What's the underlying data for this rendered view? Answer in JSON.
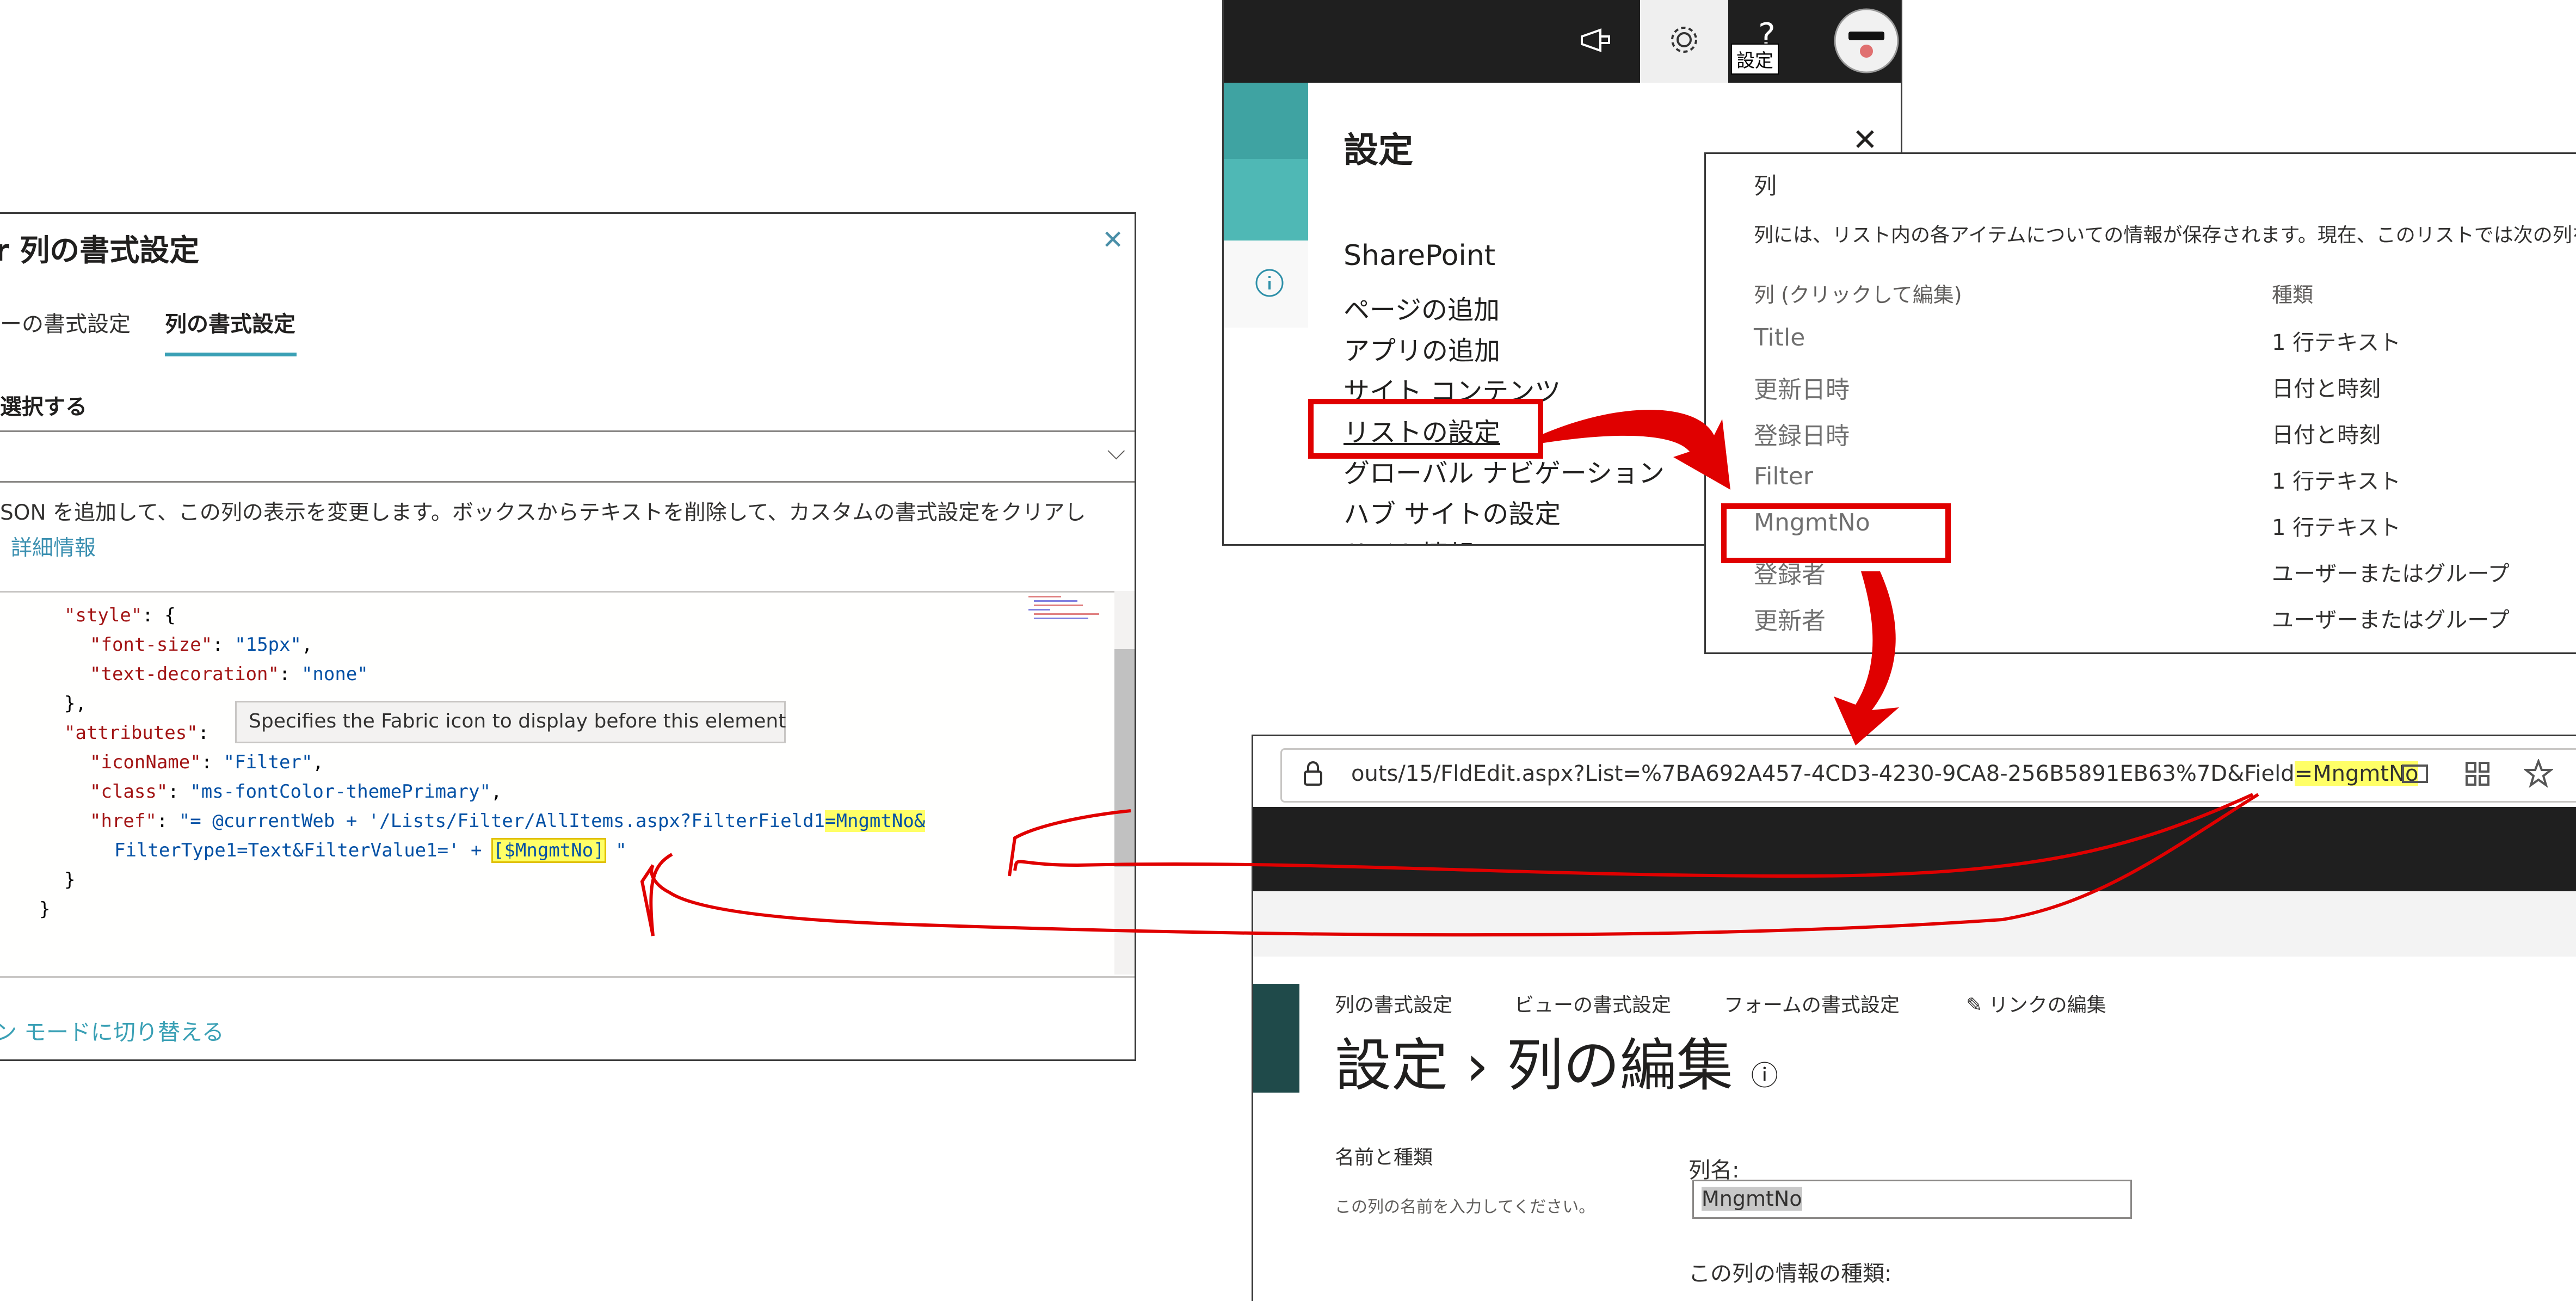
{
  "format_panel": {
    "title": "r 列の書式設定",
    "close_icon": "close-icon",
    "tab_view": "ーの書式設定",
    "tab_column": "列の書式設定",
    "select_label": "選択する",
    "description": "SON を追加して、この列の表示を変更します。ボックスからテキストを削除して、カスタムの書式設定をクリアし",
    "more_info": "詳細情報",
    "tooltip": "Specifies the Fabric icon to display before this element",
    "switch_mode": "ン モードに切り替える",
    "code": {
      "style_key": "\"style\"",
      "font_size_key": "\"font-size\"",
      "font_size_val": "\"15px\"",
      "text_decoration_key": "\"text-decoration\"",
      "text_decoration_val": "\"none\"",
      "attributes_key": "\"attributes\"",
      "icon_name_key": "\"iconName\"",
      "icon_name_val": "\"Filter\"",
      "class_key": "\"class\"",
      "class_val": "\"ms-fontColor-themePrimary\"",
      "href_key": "\"href\"",
      "href_val_1": "\"= @currentWeb + '/Lists/Filter/AllItems.aspx?FilterField1",
      "href_val_hl": "=MngmtNo&",
      "href_val_2": "FilterType1=Text&FilterValue1=' + ",
      "href_val_hl2": "[$MngmtNo]",
      "href_val_3": " \""
    }
  },
  "settings_panel": {
    "title": "設定",
    "tooltip": "設定",
    "section": "SharePoint",
    "links": [
      "ページの追加",
      "アプリの追加",
      "サイト コンテンツ",
      "リストの設定",
      "グローバル ナビゲーション",
      "ハブ サイトの設定",
      "サイト情報"
    ],
    "icons": [
      "megaphone-icon",
      "gear-icon",
      "help-icon",
      "avatar"
    ]
  },
  "columns_panel": {
    "title": "列",
    "description": "列には、リスト内の各アイテムについての情報が保存されます。現在、このリストでは次の列を使用",
    "header_name": "列 (クリックして編集)",
    "header_type": "種類",
    "rows": [
      {
        "name": "Title",
        "type": "1 行テキスト"
      },
      {
        "name": "更新日時",
        "type": "日付と時刻"
      },
      {
        "name": "登録日時",
        "type": "日付と時刻"
      },
      {
        "name": "Filter",
        "type": "1 行テキスト"
      },
      {
        "name": "MngmtNo",
        "type": "1 行テキスト"
      },
      {
        "name": "登録者",
        "type": "ユーザーまたはグループ"
      },
      {
        "name": "更新者",
        "type": "ユーザーまたはグループ"
      }
    ]
  },
  "edit_page": {
    "url_prefix": "outs/15/FldEdit.aspx?List=%7BA692A457-4CD3-4230-9CA8-256B5891EB63%7D&Field",
    "url_highlight": "=MngmtNo",
    "tabs": [
      "列の書式設定",
      "ビューの書式設定",
      "フォームの書式設定",
      "リンクの編集"
    ],
    "title": "設定 › 列の編集",
    "section": "名前と種類",
    "section_sub": "この列の名前を入力してください。",
    "field_label": "列名:",
    "field_value": "MngmtNo",
    "type_label": "この列の情報の種類:"
  },
  "colors": {
    "accent": "#3aa0b5",
    "highlight": "#ffff66",
    "annotation": "#e00000"
  }
}
